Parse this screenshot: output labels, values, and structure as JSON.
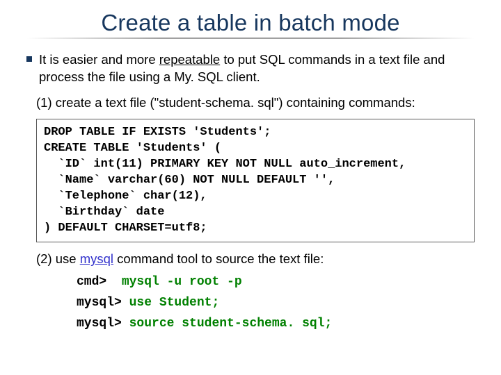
{
  "title": "Create a table in batch mode",
  "intro": {
    "pre": "It is easier and more ",
    "emph": "repeatable",
    "post": " to put SQL commands in a text file and process the file using a My. SQL client."
  },
  "step1": "(1) create a text file (\"student-schema. sql\") containing commands:",
  "codebox": "DROP TABLE IF EXISTS 'Students';\nCREATE TABLE 'Students' (\n  `ID` int(11) PRIMARY KEY NOT NULL auto_increment,\n  `Name` varchar(60) NOT NULL DEFAULT '',\n  `Telephone` char(12),\n  `Birthday` date\n) DEFAULT CHARSET=utf8;",
  "step2": {
    "pre": "(2) use ",
    "link": "mysql",
    "post": " command tool to source the text file:"
  },
  "cmd1": {
    "prompt": "cmd>  ",
    "body": "mysql -u root -p"
  },
  "cmd2": {
    "prompt": "mysql> ",
    "body": "use Student;"
  },
  "cmd3": {
    "prompt": "mysql> ",
    "body": "source student-schema. sql;"
  }
}
